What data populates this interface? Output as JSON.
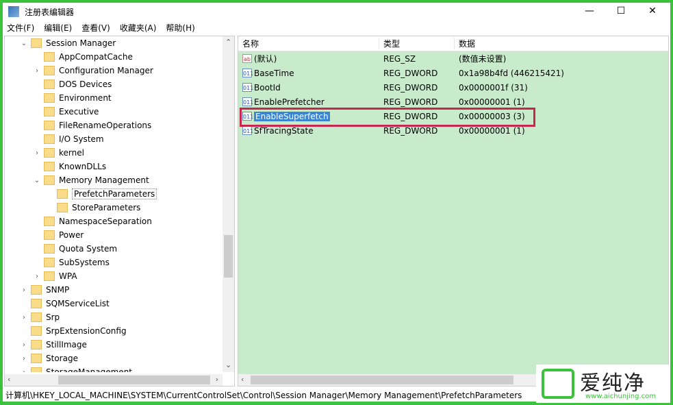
{
  "window": {
    "title": "注册表编辑器",
    "minimize": "—",
    "maximize": "☐",
    "close": "✕"
  },
  "menu": [
    "文件(F)",
    "编辑(E)",
    "查看(V)",
    "收藏夹(A)",
    "帮助(H)"
  ],
  "tree": [
    {
      "label": "Session Manager",
      "level": 0,
      "expander": "open"
    },
    {
      "label": "AppCompatCache",
      "level": 1,
      "expander": ""
    },
    {
      "label": "Configuration Manager",
      "level": 1,
      "expander": "closed"
    },
    {
      "label": "DOS Devices",
      "level": 1,
      "expander": ""
    },
    {
      "label": "Environment",
      "level": 1,
      "expander": ""
    },
    {
      "label": "Executive",
      "level": 1,
      "expander": ""
    },
    {
      "label": "FileRenameOperations",
      "level": 1,
      "expander": ""
    },
    {
      "label": "I/O System",
      "level": 1,
      "expander": ""
    },
    {
      "label": "kernel",
      "level": 1,
      "expander": "closed"
    },
    {
      "label": "KnownDLLs",
      "level": 1,
      "expander": ""
    },
    {
      "label": "Memory Management",
      "level": 1,
      "expander": "open"
    },
    {
      "label": "PrefetchParameters",
      "level": 2,
      "expander": "",
      "selected": true
    },
    {
      "label": "StoreParameters",
      "level": 2,
      "expander": ""
    },
    {
      "label": "NamespaceSeparation",
      "level": 1,
      "expander": ""
    },
    {
      "label": "Power",
      "level": 1,
      "expander": ""
    },
    {
      "label": "Quota System",
      "level": 1,
      "expander": ""
    },
    {
      "label": "SubSystems",
      "level": 1,
      "expander": ""
    },
    {
      "label": "WPA",
      "level": 1,
      "expander": "closed"
    },
    {
      "label": "SNMP",
      "level": 0,
      "expander": "closed"
    },
    {
      "label": "SQMServiceList",
      "level": 0,
      "expander": ""
    },
    {
      "label": "Srp",
      "level": 0,
      "expander": "closed"
    },
    {
      "label": "SrpExtensionConfig",
      "level": 0,
      "expander": ""
    },
    {
      "label": "StillImage",
      "level": 0,
      "expander": "closed"
    },
    {
      "label": "Storage",
      "level": 0,
      "expander": "closed"
    },
    {
      "label": "StorageManagement",
      "level": 0,
      "expander": "closed"
    }
  ],
  "columns": {
    "name": "名称",
    "type": "类型",
    "data": "数据"
  },
  "values": [
    {
      "icon": "string-value-icon",
      "glyph": "ab",
      "name": "(默认)",
      "type": "REG_SZ",
      "data": "(数值未设置)"
    },
    {
      "icon": "binary-value-icon",
      "glyph": "011",
      "name": "BaseTime",
      "type": "REG_DWORD",
      "data": "0x1a98b4fd (446215421)"
    },
    {
      "icon": "binary-value-icon",
      "glyph": "011",
      "name": "BootId",
      "type": "REG_DWORD",
      "data": "0x0000001f (31)"
    },
    {
      "icon": "binary-value-icon",
      "glyph": "011",
      "name": "EnablePrefetcher",
      "type": "REG_DWORD",
      "data": "0x00000001 (1)"
    },
    {
      "icon": "binary-value-icon",
      "glyph": "011",
      "name": "EnableSuperfetch",
      "type": "REG_DWORD",
      "data": "0x00000003 (3)",
      "selected": true
    },
    {
      "icon": "binary-value-icon",
      "glyph": "011",
      "name": "SfTracingState",
      "type": "REG_DWORD",
      "data": "0x00000001 (1)"
    }
  ],
  "status_path": "计算机\\HKEY_LOCAL_MACHINE\\SYSTEM\\CurrentControlSet\\Control\\Session Manager\\Memory Management\\PrefetchParameters",
  "watermark": {
    "text": "爱纯净",
    "url": "www.aichunjing.com"
  },
  "colors": {
    "frame": "#3cc23c",
    "highlight_box": "#c8254f",
    "selection": "#3a86d4",
    "pane_bg": "#c8ebcb"
  }
}
